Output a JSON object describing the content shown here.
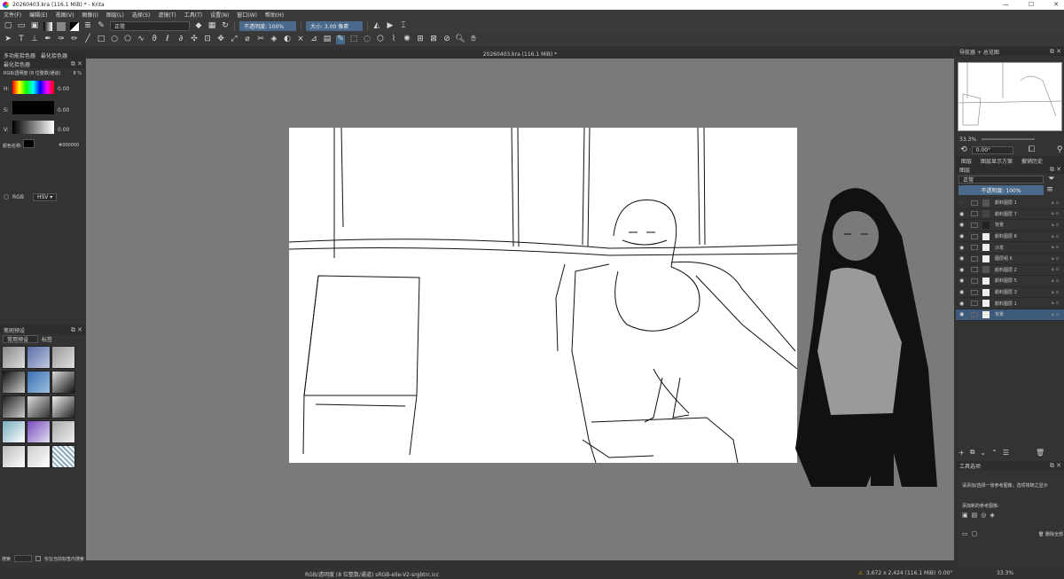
{
  "window": {
    "title": "20260403.kra (116.1 MiB) * - Krita",
    "min": "—",
    "max": "☐",
    "close": "✕"
  },
  "menu": [
    "文件(F)",
    "编辑(E)",
    "视图(V)",
    "图像(I)",
    "图层(L)",
    "选择(S)",
    "滤镜(T)",
    "工具(T)",
    "设置(N)",
    "窗口(W)",
    "帮助(H)"
  ],
  "toolbar": {
    "blend_mode": "正常",
    "opacity": "不透明度: 100%",
    "size": "大小: 3.00 像素"
  },
  "doc_tab": "20260403.kra (116.1 MiB) *",
  "left": {
    "dock_tabs": [
      "多功能拾色器",
      "最化拾色器"
    ],
    "color_panel_title": "最化拾色器",
    "color_model": "RGB/透明度 (8 位整数/通道)",
    "color_sliders": [
      {
        "label": "H:",
        "value": "0.00"
      },
      {
        "label": "S:",
        "value": "0.00"
      },
      {
        "label": "V:",
        "value": "0.00"
      }
    ],
    "color_name_label": "颜色名称:",
    "hex": "#000000",
    "model_radio": "RGB",
    "model_select": "HSV",
    "brush_panel_title": "笔刷预设",
    "brush_tag": "常用预设",
    "brush_tag_btn": "标签",
    "search_label": "搜索",
    "filter_label": "仅在当前标签内搜索"
  },
  "right": {
    "overview_title": "导航器 + 总览图",
    "zoom": "33.3%",
    "rotation": "0.00°",
    "tabs": [
      "图层",
      "图层显示方案",
      "撤销历史"
    ],
    "layers_title": "图层",
    "blend": "正常",
    "opacity": "不透明度: 100%",
    "layers": [
      {
        "name": "颜料图层 1",
        "visible": false,
        "sub": true
      },
      {
        "name": "颜料图层 7",
        "visible": true,
        "sub": true
      },
      {
        "name": "背景",
        "visible": true,
        "sub": false
      },
      {
        "name": "颜料图层 8",
        "visible": true,
        "sub": false
      },
      {
        "name": "沙发",
        "visible": true,
        "sub": false
      },
      {
        "name": "图层组 6",
        "visible": true,
        "sub": false
      },
      {
        "name": "颜料图层 2",
        "visible": true,
        "sub": true
      },
      {
        "name": "颜料图层 5",
        "visible": true,
        "sub": true
      },
      {
        "name": "颜料图层 3",
        "visible": true,
        "sub": true
      },
      {
        "name": "颜料图层 1",
        "visible": true,
        "sub": true
      },
      {
        "name": "背景",
        "visible": true,
        "sub": false,
        "selected": true
      }
    ],
    "tool_options_title": "工具选项",
    "tool_options_text": "请添加/选择一张参考图像，选项将随之显示",
    "add_ref_label": "添加新的参考图像:",
    "delete_all": "删除全部"
  },
  "status": {
    "color": "RGB/透明度 (8 位整数/通道)  sRGB-elle-V2-srgbtrc.icc",
    "dims": "3,672 x 2,424 (116.1 MiB)",
    "rotation": "0.00°",
    "zoom": "33.3%"
  },
  "colors": {
    "accent": "#4a6a8c",
    "selected_layer": "#3d5a7a",
    "canvas_bg": "#7a7a7a"
  }
}
